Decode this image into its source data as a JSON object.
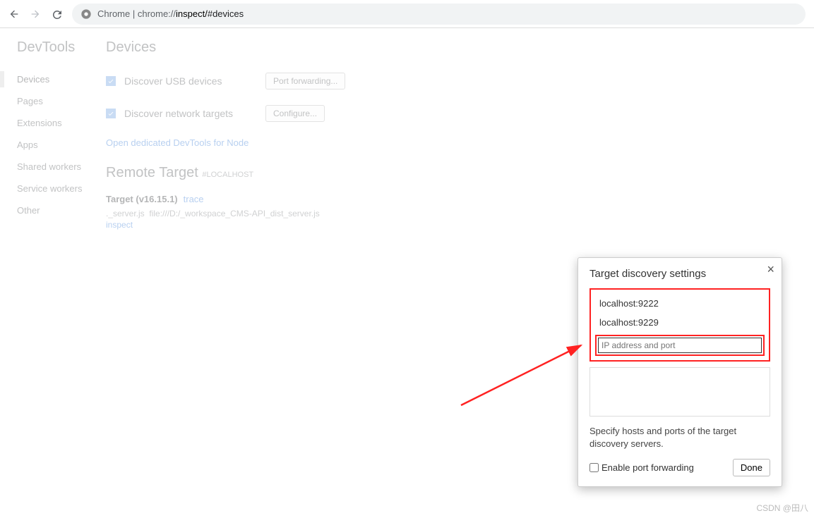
{
  "browser": {
    "url_display_prefix": "Chrome | chrome://",
    "url_display_bold": "inspect/",
    "url_display_suffix": "#devices"
  },
  "sidebar": {
    "title": "DevTools",
    "items": [
      {
        "label": "Devices",
        "active": true
      },
      {
        "label": "Pages"
      },
      {
        "label": "Extensions"
      },
      {
        "label": "Apps"
      },
      {
        "label": "Shared workers"
      },
      {
        "label": "Service workers"
      },
      {
        "label": "Other"
      }
    ]
  },
  "main": {
    "title": "Devices",
    "rows": [
      {
        "label": "Discover USB devices",
        "checked": true,
        "button": "Port forwarding..."
      },
      {
        "label": "Discover network targets",
        "checked": true,
        "button": "Configure..."
      }
    ],
    "open_node_link": "Open dedicated DevTools for Node",
    "remote_target_title": "Remote Target",
    "remote_target_sub": "#LOCALHOST",
    "target_version": "Target (v16.15.1)",
    "trace_label": "trace",
    "file_name": "._server.js",
    "file_path": "file:///D:/_workspace_CMS-API_dist_server.js",
    "inspect_label": "inspect"
  },
  "modal": {
    "title": "Target discovery settings",
    "hosts": [
      "localhost:9222",
      "localhost:9229"
    ],
    "input_placeholder": "IP address and port",
    "description": "Specify hosts and ports of the target discovery servers.",
    "enable_pf_label": "Enable port forwarding",
    "done_label": "Done"
  },
  "watermark": "CSDN @田八"
}
